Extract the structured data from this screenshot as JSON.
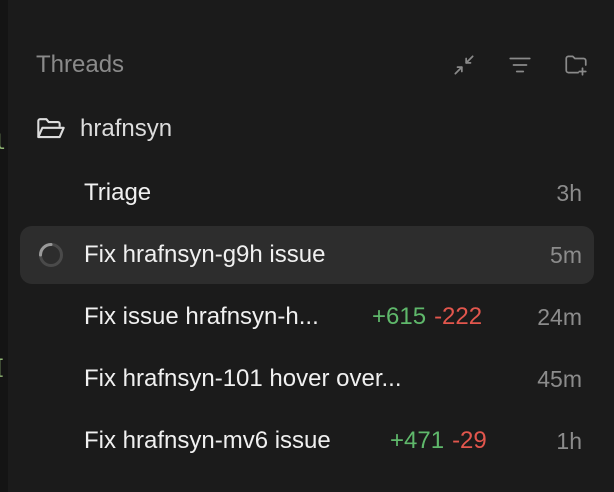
{
  "sidebar": {
    "title": "Threads",
    "icons": [
      "collapse-icon",
      "filter-icon",
      "new-folder-icon"
    ],
    "project": {
      "name": "hrafnsyn",
      "icon": "folder-open-icon"
    }
  },
  "threads": [
    {
      "title": "Triage",
      "additions": "",
      "deletions": "",
      "time": "3h",
      "active": false,
      "loading": false
    },
    {
      "title": "Fix hrafnsyn-g9h issue",
      "additions": "",
      "deletions": "",
      "time": "5m",
      "active": true,
      "loading": true
    },
    {
      "title": "Fix issue hrafnsyn-h...",
      "additions": "+615",
      "deletions": "-222",
      "time": "24m",
      "active": false,
      "loading": false
    },
    {
      "title": "Fix hrafnsyn-101 hover over...",
      "additions": "",
      "deletions": "",
      "time": "45m",
      "active": false,
      "loading": false
    },
    {
      "title": "Fix hrafnsyn-mv6 issue",
      "additions": "+471",
      "deletions": "-29",
      "time": "1h",
      "active": false,
      "loading": false
    }
  ],
  "colors": {
    "background": "#1b1b1b",
    "active_row": "#2d2d2d",
    "additions": "#5fb86b",
    "deletions": "#e2564d"
  }
}
